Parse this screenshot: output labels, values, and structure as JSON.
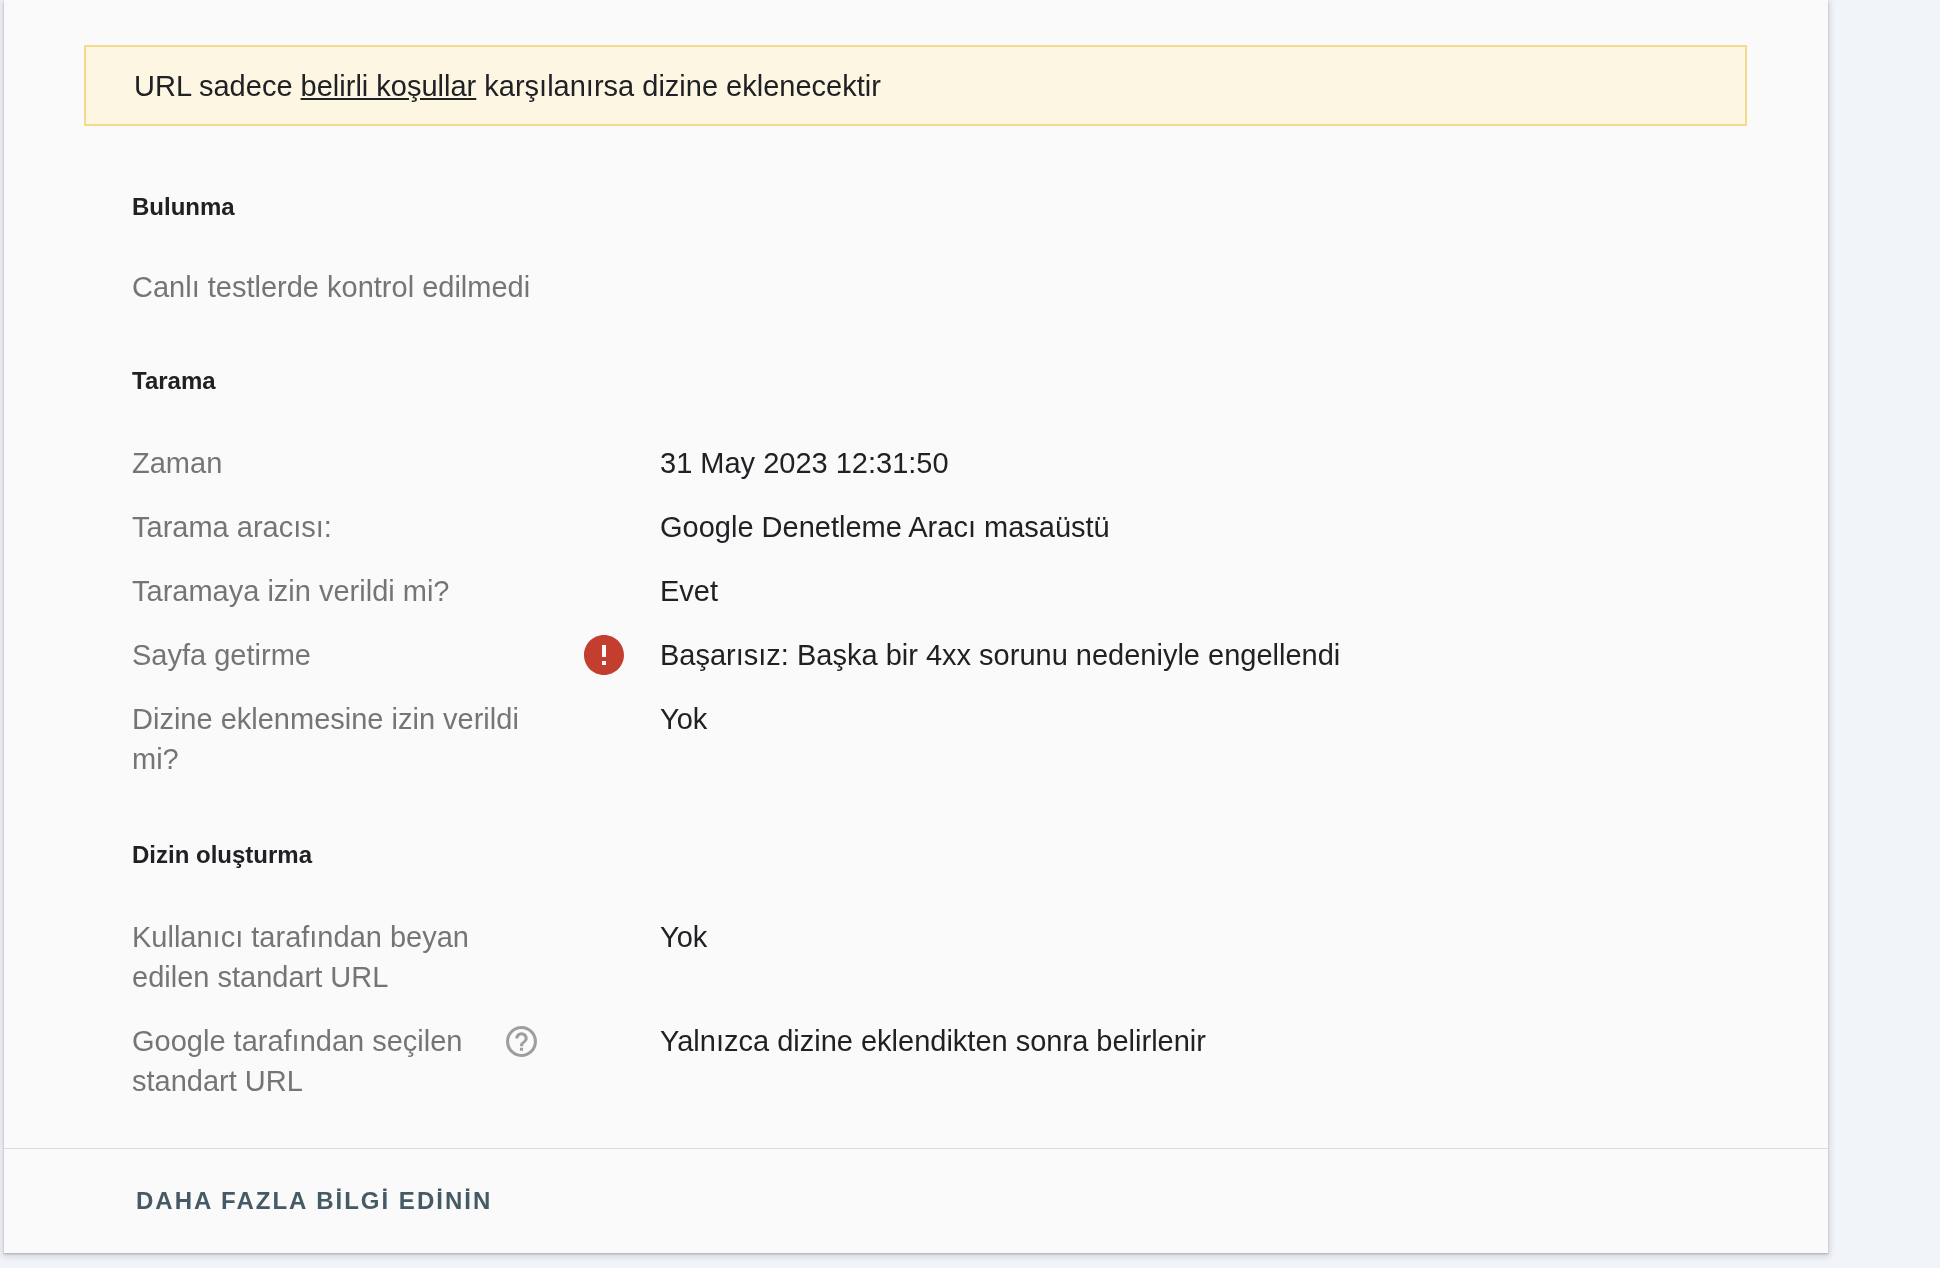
{
  "banner": {
    "text_before": "URL sadece",
    "link": "belirli koşullar",
    "text_after": "karşılanırsa dizine eklenecektir"
  },
  "sections": [
    {
      "title": "Bulunma",
      "note": "Canlı testlerde kontrol edilmedi"
    },
    {
      "title": "Tarama",
      "rows": [
        {
          "label": "Zaman",
          "help": false,
          "error": false,
          "value": "31 May 2023 12:31:50"
        },
        {
          "label": "Tarama aracısı:",
          "help": false,
          "error": false,
          "value": "Google Denetleme Aracı masaüstü"
        },
        {
          "label": "Taramaya izin verildi mi?",
          "help": false,
          "error": false,
          "value": "Evet"
        },
        {
          "label": "Sayfa getirme",
          "help": false,
          "error": true,
          "value": "Başarısız: Başka bir 4xx sorunu nedeniyle engellendi"
        },
        {
          "label": "Dizine eklenmesine izin verildi mi?",
          "help": false,
          "error": false,
          "value": "Yok"
        }
      ]
    },
    {
      "title": "Dizin oluşturma",
      "rows": [
        {
          "label": "Kullanıcı tarafından beyan edilen standart URL",
          "help": false,
          "error": false,
          "value": "Yok"
        },
        {
          "label": "Google tarafından seçilen standart URL",
          "help": true,
          "error": false,
          "value": "Yalnızca dizine eklendikten sonra belirlenir"
        }
      ]
    }
  ],
  "footer": {
    "button": "DAHA FAZLA BİLGİ EDİNİN"
  }
}
